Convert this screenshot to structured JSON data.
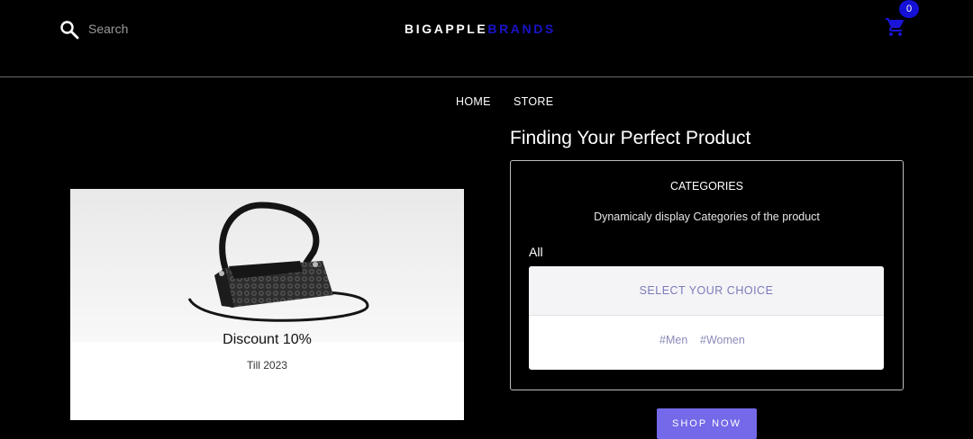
{
  "header": {
    "search_placeholder": "Search",
    "brand_part1": "BIGAPPLE",
    "brand_part2": "BRANDS",
    "brand_accent_color": "#1a14c8",
    "cart_count": "0",
    "icons": [
      "search-icon",
      "cart-icon"
    ]
  },
  "nav": {
    "items": [
      {
        "label": "HOME"
      },
      {
        "label": "STORE"
      }
    ]
  },
  "promo": {
    "discount": "Discount 10%",
    "till": "Till 2023"
  },
  "finder": {
    "title": "Finding Your Perfect Product",
    "categories_heading": "CATEGORIES",
    "categories_description": "Dynamicaly display Categories of the product",
    "all_label": "All",
    "select_label": "SELECT YOUR CHOICE",
    "tags": [
      "#Men",
      "#Women"
    ]
  },
  "cta": {
    "shop_now": "SHOP NOW",
    "color": "#7469e8"
  }
}
